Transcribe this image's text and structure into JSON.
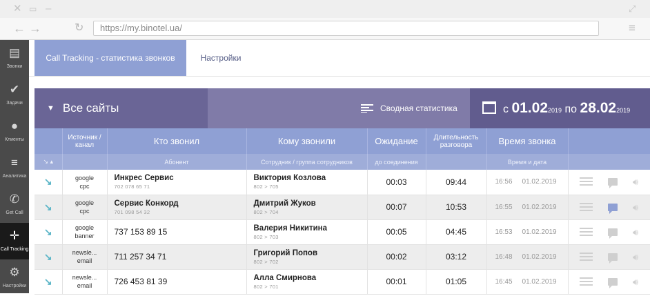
{
  "browser": {
    "url": "https://my.binotel.ua/"
  },
  "sidebar": {
    "items": [
      {
        "label": "Звонки",
        "icon": "calls-icon",
        "glyph": "▤"
      },
      {
        "label": "Задачи",
        "icon": "check-icon",
        "glyph": "✔"
      },
      {
        "label": "Клиенты",
        "icon": "person-icon",
        "glyph": "●"
      },
      {
        "label": "Аналитика",
        "icon": "analytics-icon",
        "glyph": "≡"
      },
      {
        "label": "Get Call",
        "icon": "phone-icon",
        "glyph": "✆"
      },
      {
        "label": "Call Tracking",
        "icon": "crosshair-icon",
        "glyph": "✛"
      },
      {
        "label": "Настройки",
        "icon": "gear-icon",
        "glyph": "⚙"
      }
    ],
    "active": "Call Tracking"
  },
  "tabs": [
    {
      "label": "Call Tracking - статистика звонков",
      "active": true
    },
    {
      "label": "Настройки",
      "active": false
    }
  ],
  "filter": {
    "sites_label": "Все сайты",
    "summary_label": "Сводная статистика",
    "date_from_prefix": "с",
    "date_from": "01.02",
    "date_from_year": "2019",
    "date_to_prefix": "по",
    "date_to": "28.02",
    "date_to_year": "2019"
  },
  "table": {
    "headers": {
      "source": "Источник / канал",
      "caller": "Кто звонил",
      "callee": "Кому звонили",
      "wait": "Ожидание",
      "duration": "Длительность разговора",
      "time": "Время звонка"
    },
    "subheaders": {
      "sort": "↘ ▴",
      "caller": "Абонент",
      "callee": "Сотрудник / группа сотрудников",
      "wait": "до соединения",
      "time": "Время и дата"
    },
    "rows": [
      {
        "src1": "google",
        "src2": "cpc",
        "caller_name": "Инкрес Сервис",
        "caller_phone": "702 078 65 71",
        "callee_name": "Виктория Козлова",
        "callee_ext": "802 > 705",
        "wait": "00:03",
        "duration": "09:44",
        "time": "16:56",
        "date": "01.02.2019",
        "has_comment": false
      },
      {
        "src1": "google",
        "src2": "cpc",
        "caller_name": "Сервис Конкорд",
        "caller_phone": "701 098 54 32",
        "callee_name": "Дмитрий Жуков",
        "callee_ext": "802 > 704",
        "wait": "00:07",
        "duration": "10:53",
        "time": "16:55",
        "date": "01.02.2019",
        "has_comment": true
      },
      {
        "src1": "google",
        "src2": "banner",
        "caller_name": "",
        "caller_phone": "737 153 89 15",
        "callee_name": "Валерия Никитина",
        "callee_ext": "802 > 703",
        "wait": "00:05",
        "duration": "04:45",
        "time": "16:53",
        "date": "01.02.2019",
        "has_comment": false
      },
      {
        "src1": "newsle...",
        "src2": "email",
        "caller_name": "",
        "caller_phone": "711 257 34 71",
        "callee_name": "Григорий Попов",
        "callee_ext": "802 > 702",
        "wait": "00:02",
        "duration": "03:12",
        "time": "16:48",
        "date": "01.02.2019",
        "has_comment": false
      },
      {
        "src1": "newsle...",
        "src2": "email",
        "caller_name": "",
        "caller_phone": "726 453 81 39",
        "callee_name": "Алла Смирнова",
        "callee_ext": "802 > 701",
        "wait": "00:01",
        "duration": "01:05",
        "time": "16:45",
        "date": "01.02.2019",
        "has_comment": false
      }
    ]
  },
  "colors": {
    "accent": "#8fa0d4",
    "band": "#6a6596",
    "sidebar": "#4a4a4a",
    "arrow": "#5bb5c7"
  }
}
